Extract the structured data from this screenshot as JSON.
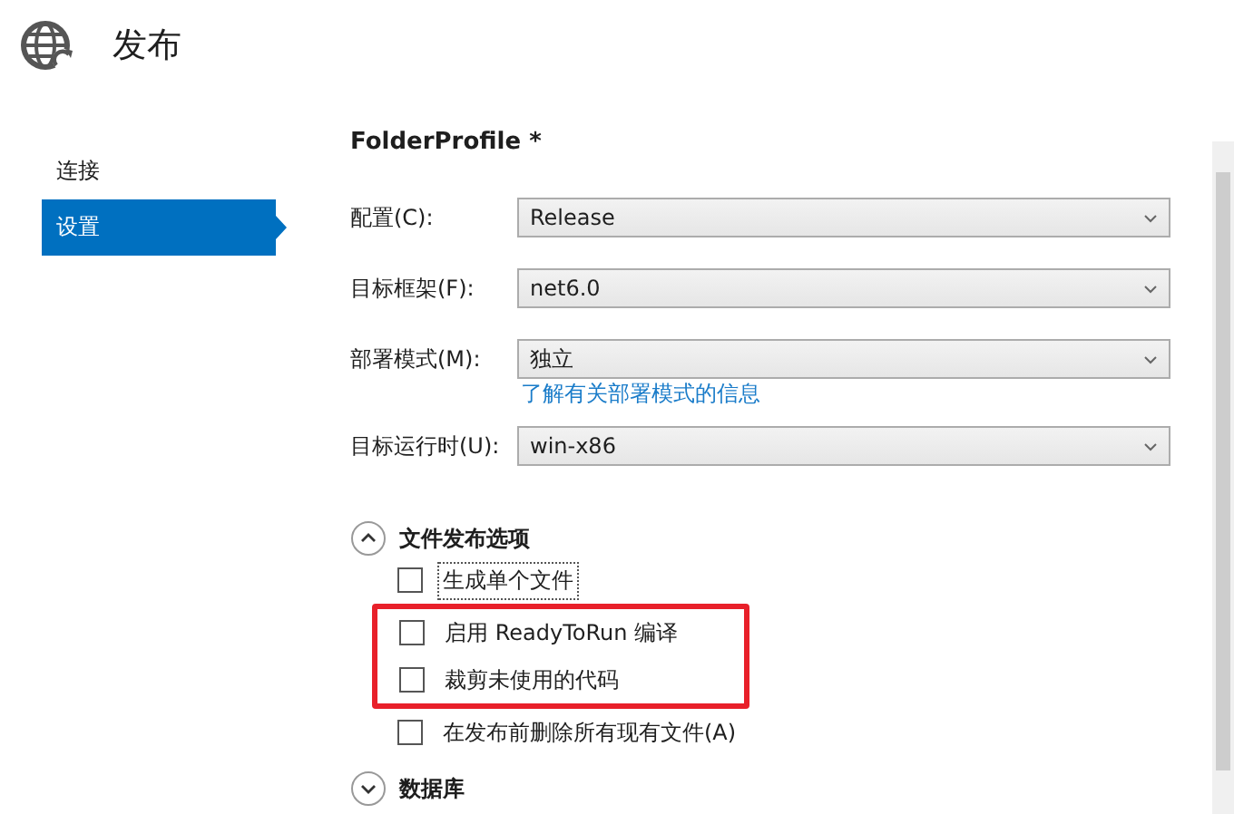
{
  "header": {
    "title": "发布"
  },
  "sidebar": {
    "items": [
      {
        "label": "连接",
        "selected": false
      },
      {
        "label": "设置",
        "selected": true
      }
    ]
  },
  "profile": {
    "title": "FolderProfile *"
  },
  "fields": [
    {
      "label": "配置(C):",
      "value": "Release"
    },
    {
      "label": "目标框架(F):",
      "value": "net6.0"
    },
    {
      "label": "部署模式(M):",
      "value": "独立",
      "link": "了解有关部署模式的信息"
    },
    {
      "label": "目标运行时(U):",
      "value": "win-x86"
    }
  ],
  "sections": [
    {
      "title": "文件发布选项",
      "expanded": true,
      "options": [
        {
          "label": "生成单个文件",
          "checked": false,
          "focused": true,
          "highlighted": false
        },
        {
          "label": "启用 ReadyToRun 编译",
          "checked": false,
          "focused": false,
          "highlighted": true
        },
        {
          "label": "裁剪未使用的代码",
          "checked": false,
          "focused": false,
          "highlighted": true
        },
        {
          "label": "在发布前删除所有现有文件(A)",
          "checked": false,
          "focused": false,
          "highlighted": false
        }
      ]
    },
    {
      "title": "数据库",
      "expanded": false
    }
  ]
}
